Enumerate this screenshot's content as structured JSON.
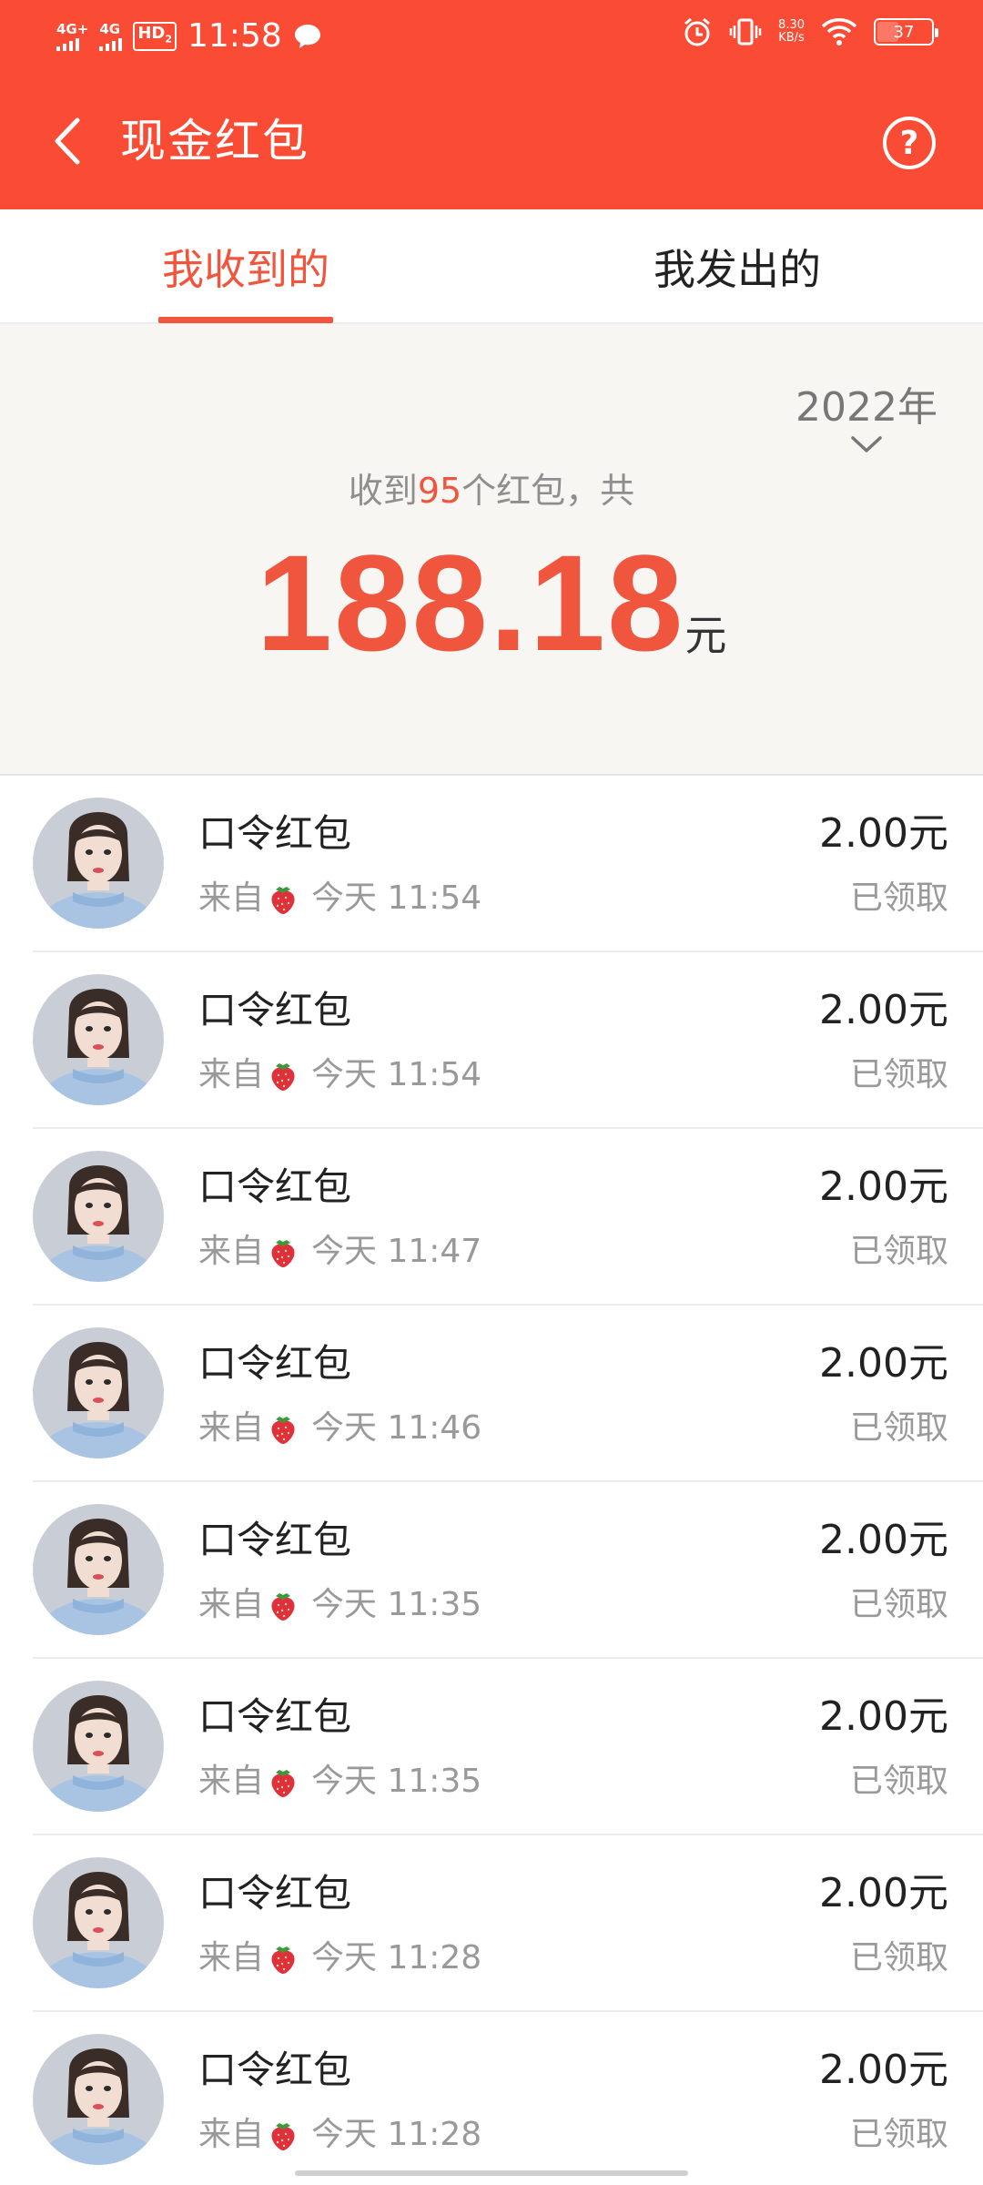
{
  "status_bar": {
    "signal1_label": "4G+",
    "signal2_label": "4G",
    "hd_label": "HD",
    "hd_sub": "2",
    "time": "11:58",
    "net_speed_value": "8.30",
    "net_speed_unit": "KB/s",
    "battery_level": "37",
    "icons": [
      "message-bubble-icon",
      "alarm-icon",
      "vibrate-icon",
      "wifi-icon",
      "battery-icon"
    ]
  },
  "header": {
    "title": "现金红包",
    "back_icon": "chevron-left-icon",
    "help_label": "?"
  },
  "tabs": [
    {
      "label": "我收到的",
      "active": true
    },
    {
      "label": "我发出的",
      "active": false
    }
  ],
  "summary": {
    "year": "2022年",
    "count_prefix": "收到",
    "count": "95",
    "count_suffix": "个红包，共",
    "total": "188.18",
    "unit": "元"
  },
  "list": [
    {
      "title": "口令红包",
      "from": "来自",
      "time": "今天 11:54",
      "amount": "2.00元",
      "status": "已领取"
    },
    {
      "title": "口令红包",
      "from": "来自",
      "time": "今天 11:54",
      "amount": "2.00元",
      "status": "已领取"
    },
    {
      "title": "口令红包",
      "from": "来自",
      "time": "今天 11:47",
      "amount": "2.00元",
      "status": "已领取"
    },
    {
      "title": "口令红包",
      "from": "来自",
      "time": "今天 11:46",
      "amount": "2.00元",
      "status": "已领取"
    },
    {
      "title": "口令红包",
      "from": "来自",
      "time": "今天 11:35",
      "amount": "2.00元",
      "status": "已领取"
    },
    {
      "title": "口令红包",
      "from": "来自",
      "time": "今天 11:35",
      "amount": "2.00元",
      "status": "已领取"
    },
    {
      "title": "口令红包",
      "from": "来自",
      "time": "今天 11:28",
      "amount": "2.00元",
      "status": "已领取"
    },
    {
      "title": "口令红包",
      "from": "来自",
      "time": "今天 11:28",
      "amount": "2.00元",
      "status": "已领取"
    }
  ],
  "colors": {
    "brand_red": "#fa4b35",
    "accent_red": "#f0553d",
    "summary_bg": "#f7f6f3",
    "secondary_text": "#999999"
  }
}
